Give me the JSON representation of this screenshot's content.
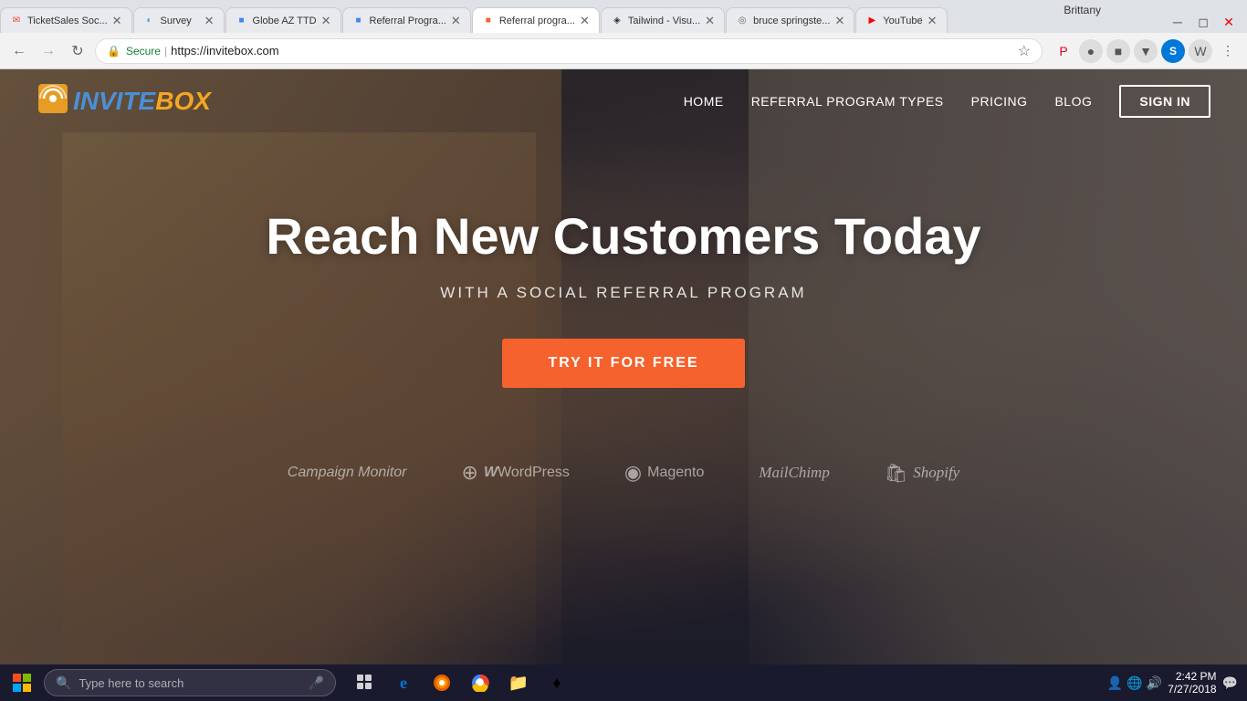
{
  "browser": {
    "tabs": [
      {
        "id": 1,
        "favicon": "✉",
        "favicon_color": "#ea4335",
        "label": "TicketSales Soc...",
        "active": false
      },
      {
        "id": 2,
        "favicon": "◐",
        "favicon_color": "#4a90d9",
        "label": "Survey",
        "active": false
      },
      {
        "id": 3,
        "favicon": "■",
        "favicon_color": "#4285f4",
        "label": "Globe AZ TTD",
        "active": false
      },
      {
        "id": 4,
        "favicon": "■",
        "favicon_color": "#4285f4",
        "label": "Referral Progra...",
        "active": false
      },
      {
        "id": 5,
        "favicon": "■",
        "favicon_color": "#f5622d",
        "label": "Referral progra...",
        "active": true
      },
      {
        "id": 6,
        "favicon": "◈",
        "favicon_color": "#333",
        "label": "Tailwind - Visu...",
        "active": false
      },
      {
        "id": 7,
        "favicon": "◎",
        "favicon_color": "#666",
        "label": "bruce springste...",
        "active": false
      },
      {
        "id": 8,
        "favicon": "▶",
        "favicon_color": "#ff0000",
        "label": "YouTube",
        "active": false
      }
    ],
    "address": {
      "secure_label": "Secure",
      "url": "https://invitebox.com"
    },
    "user": "Brittany"
  },
  "navbar": {
    "logo_invite": "INVITE",
    "logo_box": "BOX",
    "links": [
      {
        "label": "HOME"
      },
      {
        "label": "REFERRAL PROGRAM TYPES"
      },
      {
        "label": "PRICING"
      },
      {
        "label": "BLOG"
      }
    ],
    "sign_in": "SIGN IN"
  },
  "hero": {
    "title": "Reach New Customers Today",
    "subtitle": "WITH A SOCIAL REFERRAL PROGRAM",
    "cta": "TRY IT FOR FREE"
  },
  "partners": [
    {
      "label": "Campaign Monitor",
      "icon": ""
    },
    {
      "label": "WordPress",
      "icon": "⊕"
    },
    {
      "label": "Magento",
      "icon": "◉"
    },
    {
      "label": "MailChimp",
      "icon": ""
    },
    {
      "label": "Shopify",
      "icon": "🛍"
    }
  ],
  "taskbar": {
    "search_placeholder": "Type here to search",
    "clock_time": "2:42 PM",
    "clock_date": "7/27/2018",
    "apps": [
      {
        "icon": "⊞",
        "name": "start",
        "color": "#0078d7"
      },
      {
        "icon": "⊕",
        "name": "task-view",
        "color": "#fff"
      },
      {
        "icon": "e",
        "name": "edge",
        "color": "#0078d7"
      },
      {
        "icon": "◍",
        "name": "firefox",
        "color": "#e66000"
      },
      {
        "icon": "●",
        "name": "chrome",
        "color": "#4285f4"
      },
      {
        "icon": "📁",
        "name": "file-explorer",
        "color": "#ffb900"
      },
      {
        "icon": "♦",
        "name": "app6",
        "color": "#00b294"
      }
    ]
  },
  "colors": {
    "accent_orange": "#f5a623",
    "accent_blue": "#4a90d9",
    "cta_orange": "#f5622d",
    "nav_bg": "rgba(0,0,0,0.3)",
    "taskbar_bg": "#1a1a2e"
  }
}
